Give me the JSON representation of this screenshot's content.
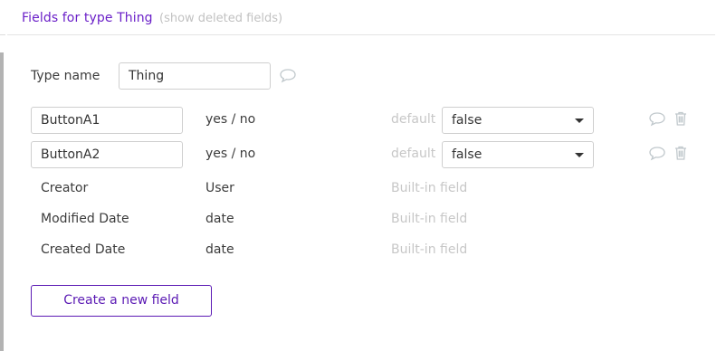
{
  "header": {
    "title": "Fields for type Thing",
    "show_deleted": "(show deleted fields)"
  },
  "type_name": {
    "label": "Type name",
    "value": "Thing",
    "note_icon": "speech-bubble-icon"
  },
  "custom_fields": [
    {
      "name": "ButtonA1",
      "type": "yes / no",
      "default_label": "default",
      "default_value": "false"
    },
    {
      "name": "ButtonA2",
      "type": "yes / no",
      "default_label": "default",
      "default_value": "false"
    }
  ],
  "builtin_fields": [
    {
      "name": "Creator",
      "type": "User",
      "note": "Built-in field"
    },
    {
      "name": "Modified Date",
      "type": "date",
      "note": "Built-in field"
    },
    {
      "name": "Created Date",
      "type": "date",
      "note": "Built-in field"
    }
  ],
  "create_button_label": "Create a new field",
  "icons": {
    "comment": "speech-bubble-icon",
    "delete": "trash-icon",
    "dropdown": "caret-down-icon"
  },
  "colors": {
    "accent": "#6a1fc8",
    "button_border": "#5b1ab4",
    "muted_text": "#c7c7c7",
    "left_bar": "#b3b3b3"
  }
}
